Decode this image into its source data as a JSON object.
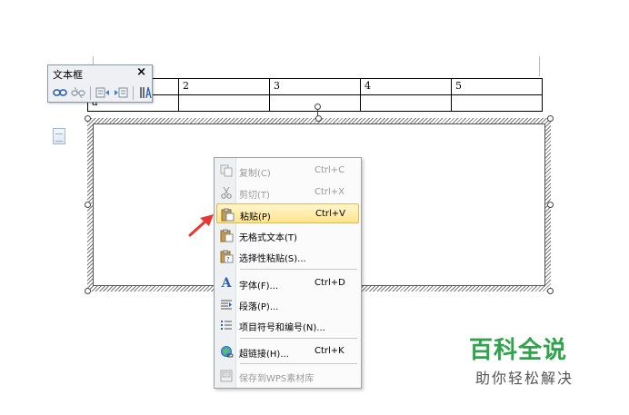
{
  "toolbar": {
    "title": "文本框",
    "close": "×",
    "buttons": [
      "link-icon",
      "unlink-icon",
      "text-box-left-icon",
      "text-box-right-icon",
      "text-direction-icon"
    ]
  },
  "table": {
    "row1": [
      "",
      "2",
      "3",
      "4",
      "5"
    ],
    "row2": [
      "a",
      "",
      "",
      "",
      ""
    ]
  },
  "context_menu": {
    "items": [
      {
        "label": "复制(C)",
        "shortcut": "Ctrl+C",
        "disabled": true,
        "icon": "copy-icon"
      },
      {
        "label": "剪切(T)",
        "shortcut": "Ctrl+X",
        "disabled": true,
        "icon": "cut-icon"
      },
      {
        "label": "粘贴(P)",
        "shortcut": "Ctrl+V",
        "disabled": false,
        "highlighted": true,
        "icon": "paste-icon"
      },
      {
        "label": "无格式文本(T)",
        "shortcut": "",
        "disabled": false,
        "icon": "paste-plain-icon"
      },
      {
        "label": "选择性粘贴(S)...",
        "shortcut": "",
        "disabled": false,
        "icon": "paste-special-icon"
      },
      {
        "label": "字体(F)...",
        "shortcut": "Ctrl+D",
        "disabled": false,
        "icon": "font-icon"
      },
      {
        "label": "段落(P)...",
        "shortcut": "",
        "disabled": false,
        "icon": "paragraph-icon"
      },
      {
        "label": "项目符号和编号(N)...",
        "shortcut": "",
        "disabled": false,
        "icon": "bullets-icon"
      },
      {
        "label": "超链接(H)...",
        "shortcut": "Ctrl+K",
        "disabled": false,
        "icon": "hyperlink-icon"
      },
      {
        "label": "保存到WPS素材库",
        "shortcut": "",
        "disabled": true,
        "icon": "save-library-icon"
      }
    ]
  },
  "watermark": {
    "title": "百科全说",
    "subtitle": "助你轻松解决"
  },
  "colors": {
    "highlight": "#ffe48a",
    "arrow": "#e8372c",
    "watermark_green": "#2ea34a"
  }
}
